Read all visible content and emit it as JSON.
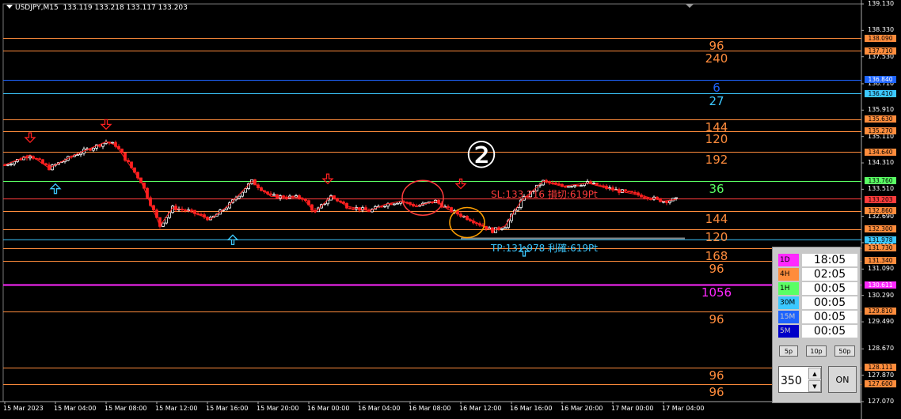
{
  "header": {
    "symbol": "USDJPY,M15",
    "ohlc": "133.119 133.218 133.117 133.203"
  },
  "chart_data": {
    "type": "candlestick",
    "symbol": "USDJPY",
    "timeframe": "M15",
    "ylim": [
      127.07,
      139.13
    ],
    "y_ticks": [
      "139.130",
      "138.330",
      "137.530",
      "136.710",
      "135.910",
      "135.110",
      "134.310",
      "133.510",
      "132.690",
      "131.890",
      "131.090",
      "130.290",
      "129.490",
      "128.670",
      "127.870",
      "127.070"
    ],
    "x_ticks": [
      "15 Mar 2023",
      "15 Mar 04:00",
      "15 Mar 08:00",
      "15 Mar 12:00",
      "15 Mar 16:00",
      "15 Mar 20:00",
      "16 Mar 00:00",
      "16 Mar 04:00",
      "16 Mar 08:00",
      "16 Mar 12:00",
      "16 Mar 16:00",
      "16 Mar 20:00",
      "17 Mar 00:00",
      "17 Mar 04:00"
    ],
    "x_range": [
      "15 Mar 2023 00:00",
      "17 Mar 05:15"
    ],
    "price_path": [
      [
        "15 Mar 2023 00:00",
        134.25
      ],
      [
        "15 Mar 02:00",
        134.55
      ],
      [
        "15 Mar 03:30",
        134.15
      ],
      [
        "15 Mar 05:30",
        134.55
      ],
      [
        "15 Mar 08:00",
        134.95
      ],
      [
        "15 Mar 08:45",
        134.85
      ],
      [
        "15 Mar 10:45",
        133.75
      ],
      [
        "15 Mar 12:15",
        132.4
      ],
      [
        "15 Mar 13:15",
        132.95
      ],
      [
        "15 Mar 14:30",
        132.85
      ],
      [
        "15 Mar 16:15",
        132.6
      ],
      [
        "15 Mar 17:45",
        133.05
      ],
      [
        "15 Mar 19:30",
        133.75
      ],
      [
        "15 Mar 21:00",
        133.3
      ],
      [
        "15 Mar 23:30",
        133.25
      ],
      [
        "16 Mar 00:30",
        132.8
      ],
      [
        "16 Mar 01:45",
        133.3
      ],
      [
        "16 Mar 03:00",
        133.0
      ],
      [
        "16 Mar 04:45",
        132.85
      ],
      [
        "16 Mar 06:00",
        133.05
      ],
      [
        "16 Mar 07:15",
        133.15
      ],
      [
        "16 Mar 08:30",
        133.0
      ],
      [
        "16 Mar 10:00",
        133.15
      ],
      [
        "16 Mar 11:00",
        132.9
      ],
      [
        "16 Mar 13:00",
        132.55
      ],
      [
        "16 Mar 14:30",
        132.25
      ],
      [
        "16 Mar 15:30",
        132.4
      ],
      [
        "16 Mar 16:45",
        133.15
      ],
      [
        "16 Mar 18:30",
        133.75
      ],
      [
        "16 Mar 20:00",
        133.6
      ],
      [
        "16 Mar 22:00",
        133.7
      ],
      [
        "17 Mar 00:00",
        133.5
      ],
      [
        "17 Mar 02:30",
        133.3
      ],
      [
        "17 Mar 04:00",
        133.15
      ],
      [
        "17 Mar 05:00",
        133.2
      ]
    ],
    "current_price": 133.203,
    "levels": [
      {
        "price": 138.09,
        "label": "96",
        "color": "#ff8c3c"
      },
      {
        "price": 137.71,
        "label": "240",
        "color": "#ff8c3c"
      },
      {
        "price": 136.84,
        "label": "6",
        "color": "#1e64ff"
      },
      {
        "price": 136.41,
        "label": "27",
        "color": "#3cc8ff"
      },
      {
        "price": 135.63,
        "label": "144",
        "color": "#ff8c3c"
      },
      {
        "price": 135.27,
        "label": "120",
        "color": "#ff8c3c"
      },
      {
        "price": 134.64,
        "label": "192",
        "color": "#ff8c3c"
      },
      {
        "price": 133.76,
        "label": "36",
        "color": "#5aff64"
      },
      {
        "price": 132.86,
        "label": "144",
        "color": "#ff8c3c"
      },
      {
        "price": 132.3,
        "label": "120",
        "color": "#ff8c3c"
      },
      {
        "price": 131.73,
        "label": "168",
        "color": "#ff8c3c"
      },
      {
        "price": 131.34,
        "label": "96",
        "color": "#ff8c3c"
      },
      {
        "price": 130.611,
        "label": "1056",
        "color": "#ff28ff"
      },
      {
        "price": 129.81,
        "label": "96",
        "color": "#ff8c3c"
      },
      {
        "price": 128.111,
        "label": "96",
        "color": "#ff8c3c"
      },
      {
        "price": 127.6,
        "label": "96",
        "color": "#ff8c3c"
      }
    ],
    "axis_boxes": [
      {
        "text": "138.090",
        "color": "#ff8c3c"
      },
      {
        "text": "137.710",
        "color": "#ff8c3c"
      },
      {
        "text": "136.840",
        "color": "#1e64ff"
      },
      {
        "text": "136.410",
        "color": "#3cc8ff"
      },
      {
        "text": "135.630",
        "color": "#ff8c3c"
      },
      {
        "text": "135.270",
        "color": "#ff8c3c"
      },
      {
        "text": "134.640",
        "color": "#ff8c3c"
      },
      {
        "text": "133.760",
        "color": "#5aff64"
      },
      {
        "text": "133.203",
        "color": "#ff3c3c"
      },
      {
        "text": "132.860",
        "color": "#ff8c3c"
      },
      {
        "text": "132.300",
        "color": "#ff8c3c"
      },
      {
        "text": "131.978",
        "color": "#3cc8ff"
      },
      {
        "text": "131.730",
        "color": "#ff8c3c"
      },
      {
        "text": "131.340",
        "color": "#ff8c3c"
      },
      {
        "text": "130.611",
        "color": "#ff28ff"
      },
      {
        "text": "129.810",
        "color": "#ff8c3c"
      },
      {
        "text": "128.111",
        "color": "#ff8c3c"
      },
      {
        "text": "127.600",
        "color": "#ff8c3c"
      }
    ],
    "sell_signals": [
      [
        "15 Mar 02:00",
        134.55
      ],
      [
        "15 Mar 08:00",
        134.95
      ],
      [
        "16 Mar 01:30",
        133.3
      ],
      [
        "16 Mar 12:00",
        133.15
      ]
    ],
    "buy_signals": [
      [
        "15 Mar 04:00",
        134.15
      ],
      [
        "15 Mar 18:00",
        132.6
      ],
      [
        "16 Mar 17:00",
        132.25
      ]
    ],
    "sl": {
      "text": "SL:133.216 損切:619Pt",
      "price": 133.216,
      "color": "#ff3c3c"
    },
    "tp": {
      "text": "TP:131.978 利確:619Pt",
      "price": 131.978,
      "color": "#3cc8ff"
    },
    "marker": "②",
    "circles": [
      {
        "time": "16 Mar 09:00",
        "price": 133.25,
        "color": "#ff3c3c"
      },
      {
        "time": "16 Mar 12:30",
        "price": 132.5,
        "color": "#ffa000"
      }
    ]
  },
  "panel": {
    "rows": [
      {
        "tf": "1D",
        "value": "18:05",
        "color": "#ff28ff"
      },
      {
        "tf": "4H",
        "value": "02:05",
        "color": "#ff8c3c"
      },
      {
        "tf": "1H",
        "value": "00:05",
        "color": "#5aff64"
      },
      {
        "tf": "30M",
        "value": "00:05",
        "color": "#3cc8ff"
      },
      {
        "tf": "15M",
        "value": "00:05",
        "color": "#1e64ff"
      },
      {
        "tf": "5M",
        "value": "00:05",
        "color": "#0000c8"
      }
    ],
    "btn_5p": "5p",
    "btn_10p": "10p",
    "btn_50p": "50p",
    "spin_value": "350",
    "spin_up": "▲",
    "spin_down": "▼",
    "on_label": "ON"
  }
}
